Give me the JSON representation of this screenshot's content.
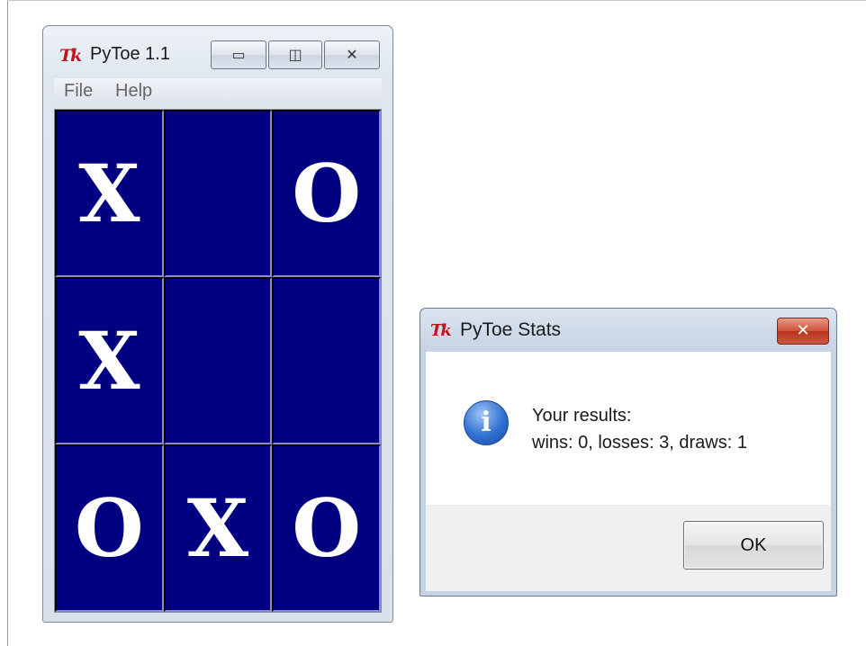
{
  "main_window": {
    "title": "PyToe 1.1",
    "icon_label": "Tk",
    "buttons": {
      "minimize": "▭",
      "maximize": "◫",
      "close": "✕"
    },
    "menu": [
      {
        "label": "File"
      },
      {
        "label": "Help"
      }
    ],
    "board": [
      [
        "X",
        "",
        "O"
      ],
      [
        "X",
        "",
        ""
      ],
      [
        "O",
        "X",
        "O"
      ]
    ]
  },
  "dialog": {
    "title": "PyToe Stats",
    "icon_label": "Tk",
    "close": "✕",
    "info_icon": "i",
    "message_line1": "Your results:",
    "message_line2": "wins: 0,  losses: 3,  draws: 1",
    "ok_label": "OK"
  },
  "colors": {
    "board_cell": "#000080",
    "mark": "#ffffff",
    "close_button": "#c95a40"
  }
}
